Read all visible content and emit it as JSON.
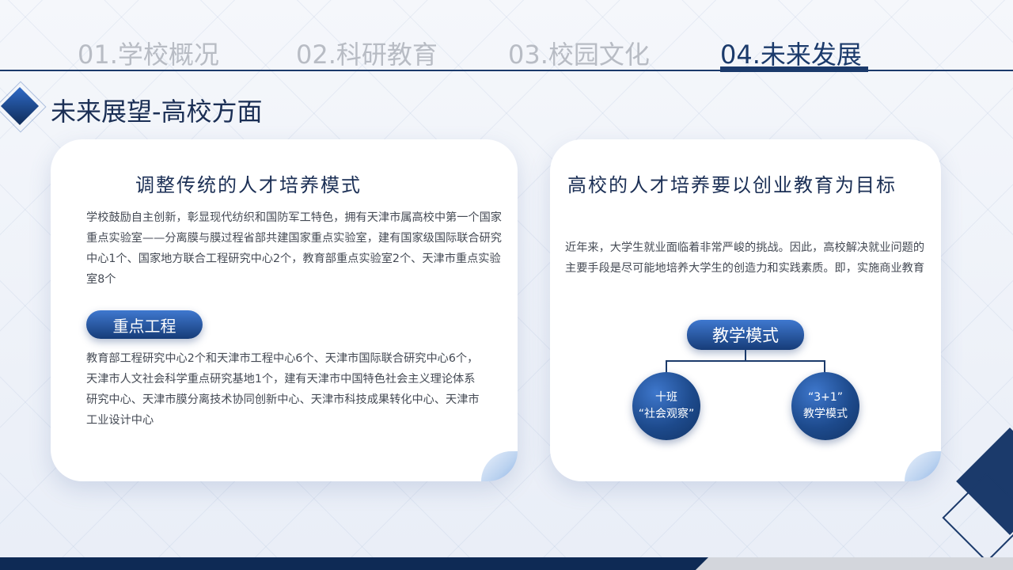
{
  "tabs": [
    {
      "label": "01.学校概况"
    },
    {
      "label": "02.科研教育"
    },
    {
      "label": "03.校园文化"
    },
    {
      "label": "04.未来发展"
    }
  ],
  "active_tab": "04.未来发展",
  "page_title": "未来展望-高校方面",
  "left_card": {
    "heading": "调整传统的人才培养模式",
    "paragraph1": "学校鼓励自主创新，彰显现代纺织和国防军工特色，拥有天津市属高校中第一个国家重点实验室——分离膜与膜过程省部共建国家重点实验室，建有国家级国际联合研究中心1个、国家地方联合工程研究中心2个，教育部重点实验室2个、天津市重点实验室8个",
    "badge": "重点工程",
    "paragraph2": "教育部工程研究中心2个和天津市工程中心6个、天津市国际联合研究中心6个，天津市人文社会科学重点研究基地1个，建有天津市中国特色社会主义理论体系研究中心、天津市膜分离技术协同创新中心、天津市科技成果转化中心、天津市工业设计中心"
  },
  "right_card": {
    "heading": "高校的人才培养要以创业教育为目标",
    "paragraph": "近年来，大学生就业面临着非常严峻的挑战。因此，高校解决就业问题的主要手段是尽可能地培养大学生的创造力和实践素质。即，实施商业教育",
    "diagram": {
      "root": "教学模式",
      "children": [
        {
          "line1": "十班",
          "line2": "“社会观察”"
        },
        {
          "line1": "“3+1”",
          "line2": "教学模式"
        }
      ]
    }
  },
  "colors": {
    "primary": "#1b3a6b",
    "accent": "#2f6ac7",
    "muted_tab": "#b8bcc4"
  }
}
